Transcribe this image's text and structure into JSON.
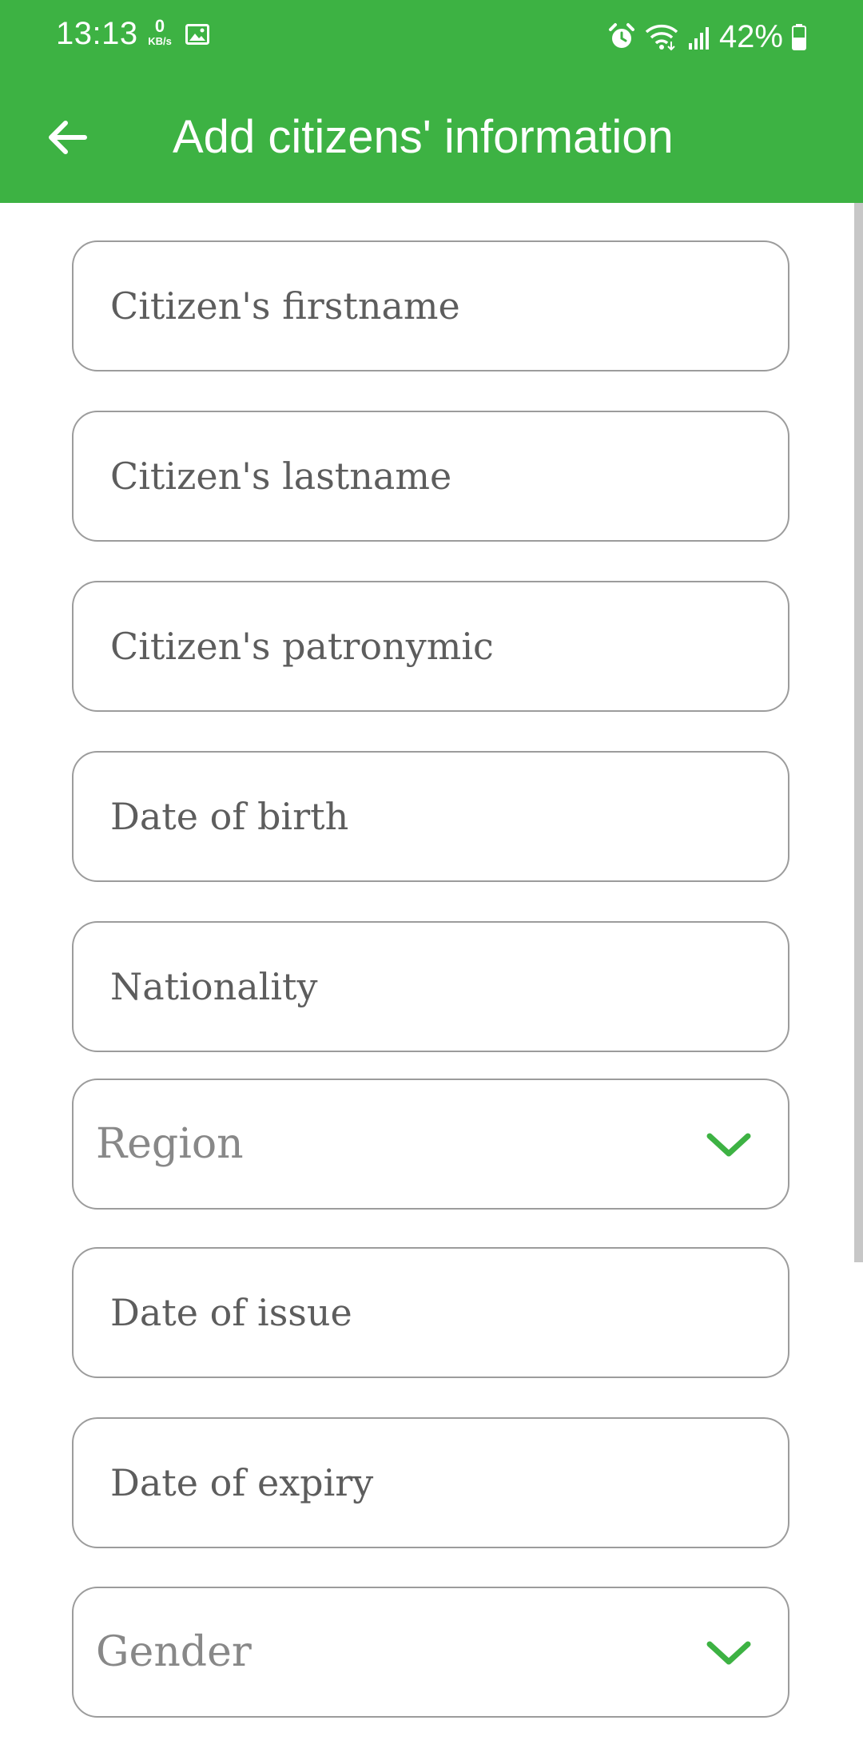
{
  "status_bar": {
    "time": "13:13",
    "net_speed_value": "0",
    "net_speed_unit": "KB/s",
    "battery": "42%"
  },
  "app_bar": {
    "title": "Add citizens' information"
  },
  "form": {
    "firstname_placeholder": "Citizen's firstname",
    "lastname_placeholder": "Citizen's lastname",
    "patronymic_placeholder": "Citizen's patronymic",
    "dob_placeholder": "Date of birth",
    "nationality_placeholder": "Nationality",
    "region_label": "Region",
    "issue_placeholder": "Date of issue",
    "expiry_placeholder": "Date of expiry",
    "gender_label": "Gender"
  },
  "colors": {
    "accent": "#3db243",
    "border": "#9c9c9c",
    "placeholder": "#5d5d5d",
    "select_text": "#888888"
  },
  "icons": {
    "back": "arrow-left-icon",
    "dropdown": "chevron-down-icon",
    "gallery": "image-icon",
    "alarm": "alarm-icon",
    "wifi": "wifi-icon",
    "signal": "signal-icon",
    "battery": "battery-icon"
  }
}
